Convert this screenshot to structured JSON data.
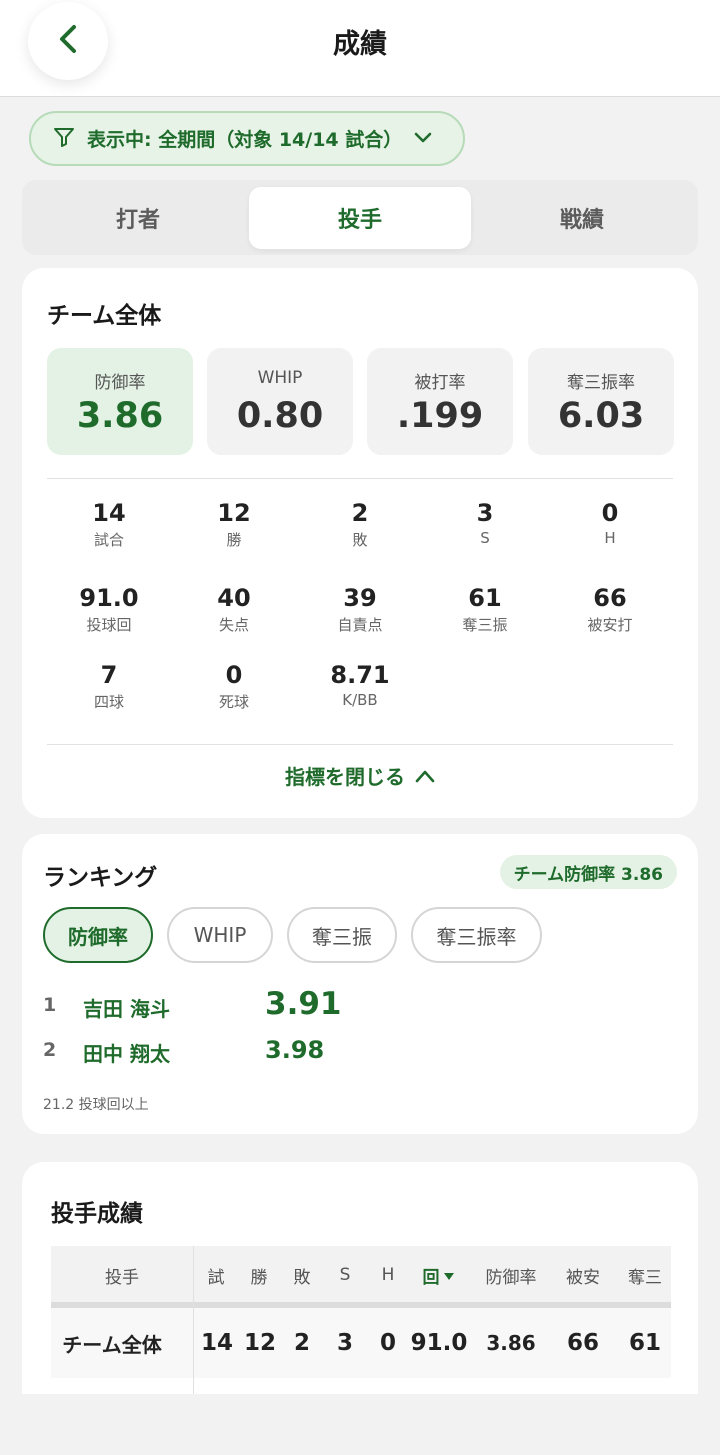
{
  "header": {
    "title": "成績"
  },
  "filter": {
    "label": "表示中: 全期間（対象 14/14 試合）"
  },
  "tabs": [
    {
      "label": "打者"
    },
    {
      "label": "投手"
    },
    {
      "label": "戦績"
    }
  ],
  "team": {
    "title": "チーム全体",
    "kpis": [
      {
        "label": "防御率",
        "value": "3.86"
      },
      {
        "label": "WHIP",
        "value": "0.80"
      },
      {
        "label": "被打率",
        "value": ".199"
      },
      {
        "label": "奪三振率",
        "value": "6.03"
      }
    ],
    "stats": [
      {
        "value": "14",
        "label": "試合"
      },
      {
        "value": "12",
        "label": "勝"
      },
      {
        "value": "2",
        "label": "敗"
      },
      {
        "value": "3",
        "label": "S"
      },
      {
        "value": "0",
        "label": "H"
      },
      {
        "value": "91.0",
        "label": "投球回"
      },
      {
        "value": "40",
        "label": "失点"
      },
      {
        "value": "39",
        "label": "自責点"
      },
      {
        "value": "61",
        "label": "奪三振"
      },
      {
        "value": "66",
        "label": "被安打"
      },
      {
        "value": "7",
        "label": "四球"
      },
      {
        "value": "0",
        "label": "死球"
      },
      {
        "value": "8.71",
        "label": "K/BB"
      }
    ],
    "close_label": "指標を閉じる"
  },
  "ranking": {
    "title": "ランキング",
    "badge": "チーム防御率 3.86",
    "chips": [
      {
        "label": "防御率"
      },
      {
        "label": "WHIP"
      },
      {
        "label": "奪三振"
      },
      {
        "label": "奪三振率"
      }
    ],
    "rows": [
      {
        "rank": "1",
        "name": "吉田 海斗",
        "value": "3.91"
      },
      {
        "rank": "2",
        "name": "田中 翔太",
        "value": "3.98"
      }
    ],
    "footnote": "21.2 投球回以上"
  },
  "pitchers": {
    "title": "投手成績",
    "headers": [
      "投手",
      "試",
      "勝",
      "敗",
      "S",
      "H",
      "回",
      "防御率",
      "被安",
      "奪三"
    ],
    "rows": [
      {
        "cells": [
          "チーム全体",
          "14",
          "12",
          "2",
          "3",
          "0",
          "91.0",
          "3.86",
          "66",
          "61"
        ]
      }
    ]
  },
  "colors": {
    "accent": "#1f6b2c",
    "accent_bg": "#e3f2e4"
  }
}
